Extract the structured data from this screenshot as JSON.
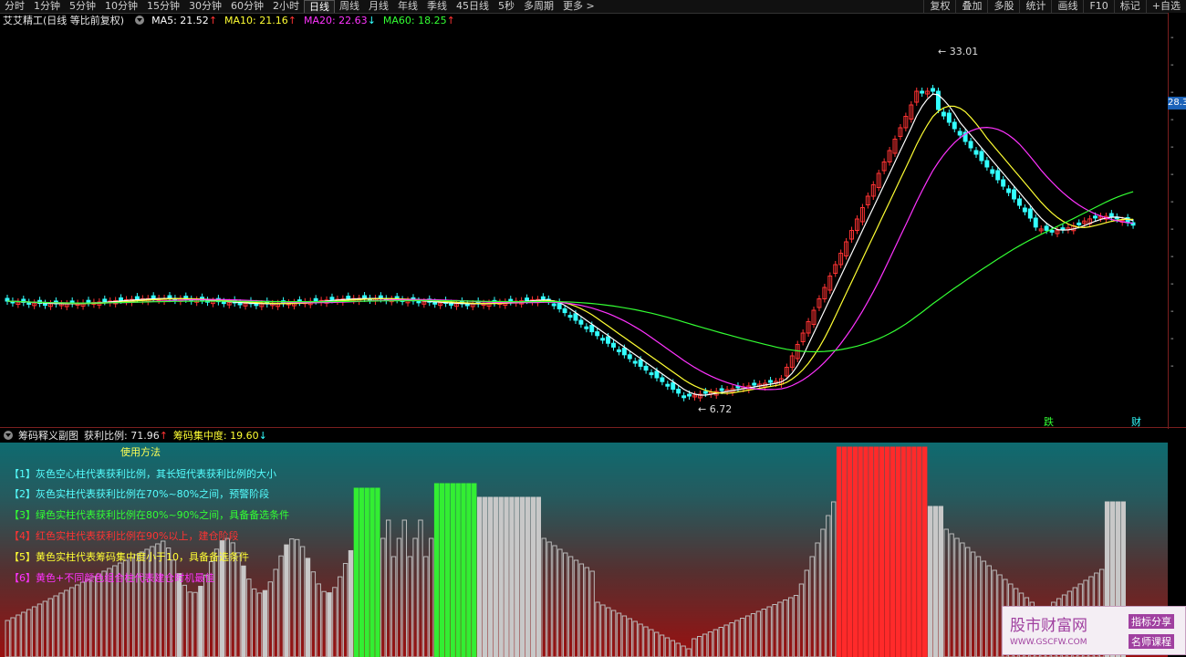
{
  "toolbar": {
    "tabs": [
      "分时",
      "1分钟",
      "5分钟",
      "10分钟",
      "15分钟",
      "30分钟",
      "60分钟",
      "2小时",
      "日线",
      "周线",
      "月线",
      "年线",
      "季线",
      "45日线",
      "5秒",
      "多周期",
      "更多 >"
    ],
    "active_tab": "日线",
    "tools": [
      "复权",
      "叠加",
      "多股",
      "统计",
      "画线",
      "F10",
      "标记",
      "+自选"
    ]
  },
  "main": {
    "title": "艾艾精工(日线 等比前复权)",
    "ma5": {
      "label": "MA5: 21.52",
      "arrow": "↑"
    },
    "ma10": {
      "label": "MA10: 21.16",
      "arrow": "↑"
    },
    "ma20": {
      "label": "MA20: 22.63",
      "arrow": "↓"
    },
    "ma60": {
      "label": "MA60: 18.25",
      "arrow": "↑"
    },
    "high_label": "33.01",
    "low_label": "6.72",
    "price_tag": "28.3",
    "tag_die": "跌",
    "tag_cai": "财",
    "colors": {
      "up": "#ff3333",
      "down": "#33ffff",
      "ma5": "#ffffff",
      "ma10": "#ffff33",
      "ma20": "#ff33ff",
      "ma60": "#33ff33"
    }
  },
  "sub": {
    "name": "筹码释义副图",
    "profit": {
      "label": "获利比例: 71.96",
      "arrow": "↑"
    },
    "concentration": {
      "label": "筹码集中度: 19.60",
      "arrow": "↓"
    },
    "legend_title": "使用方法",
    "legend": [
      {
        "text": "【1】灰色空心柱代表获利比例，其长短代表获利比例的大小",
        "color": "#55ffff"
      },
      {
        "text": "【2】灰色实柱代表获利比例在70%~80%之间，预警阶段",
        "color": "#55ffff"
      },
      {
        "text": "【3】绿色实柱代表获利比例在80%~90%之间，具备备选条件",
        "color": "#33ff33"
      },
      {
        "text": "【4】红色实柱代表获利比例在90%以上，建仓阶段",
        "color": "#ff3333"
      },
      {
        "text": "【5】黄色实柱代表筹码集中度小于10，具备备选条件",
        "color": "#ffff33"
      },
      {
        "text": "【6】黄色+不同颜色组合柱代表建仓时机最佳",
        "color": "#ff33ff"
      }
    ]
  },
  "watermark": {
    "brand": "股市财富网",
    "url": "WWW.GSCFW.COM",
    "badge1": "指标分享",
    "badge2": "名师课程"
  },
  "chart_data": {
    "type": "candlestick",
    "high": 33.01,
    "low": 6.72,
    "indicator_bars": "profit ratio bars (gray hollow / gray solid / green / red)"
  }
}
